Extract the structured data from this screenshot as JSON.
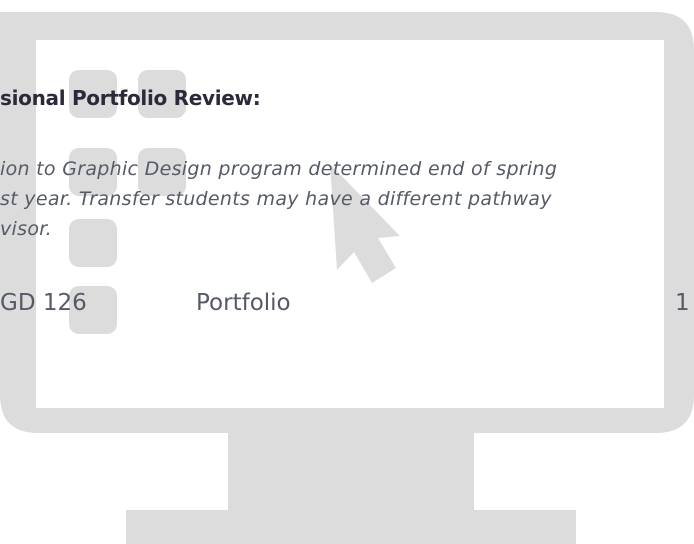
{
  "review": {
    "heading": "sional Portfolio Review:",
    "note_lines": [
      "ion to Graphic Design program determined end of spring",
      "st year. Transfer students may have a different pathway",
      "visor."
    ]
  },
  "course_row": {
    "code": "GD 126",
    "title": "Portfolio",
    "credits": "1"
  },
  "icons": {
    "monitor": "monitor-icon",
    "cursor": "cursor-arrow-icon",
    "tiles": "app-tile-icon"
  },
  "colors": {
    "monitor": "#dcdcdc",
    "text": "#555a66",
    "heading": "#2a2a3a"
  }
}
